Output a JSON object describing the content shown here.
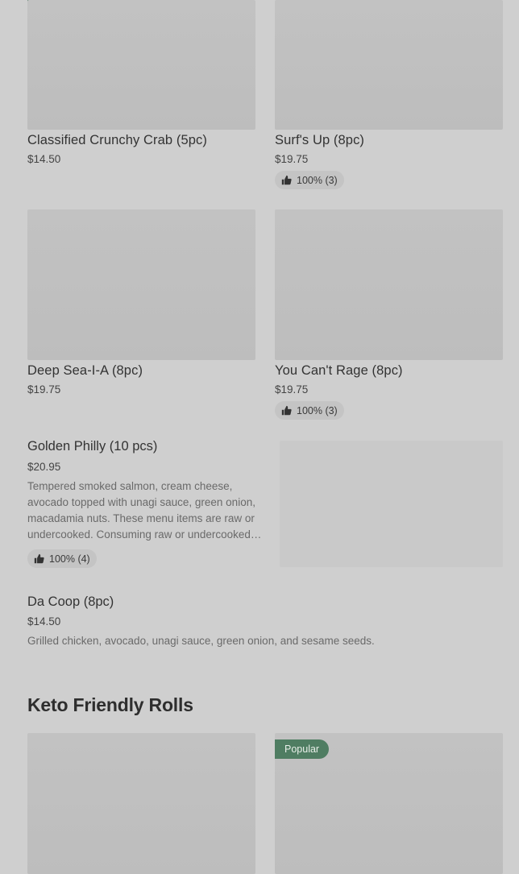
{
  "grid_row_1": [
    {
      "title": "Classified Crunchy Crab (5pc)",
      "price": "$14.50"
    },
    {
      "title": "Surf's Up (8pc)",
      "price": "$19.75",
      "rating": "100% (3)"
    }
  ],
  "grid_row_2": [
    {
      "title": "Deep Sea-I-A (8pc)",
      "price": "$19.75"
    },
    {
      "title": "You Can't Rage (8pc)",
      "price": "$19.75",
      "rating": "100% (3)"
    }
  ],
  "list_items": [
    {
      "title": "Golden Philly (10 pcs)",
      "price": "$20.95",
      "description": "Tempered smoked salmon, cream cheese, avocado topped with unagi sauce, green onion, macadamia nuts. These menu items are raw or undercooked. Consuming raw or undercooked…",
      "rating": "100% (4)"
    },
    {
      "title": "Da Coop (8pc)",
      "price": "$14.50",
      "description": "Grilled chicken, avocado, unagi sauce, green onion, and sesame seeds."
    }
  ],
  "section": {
    "heading": "Keto Friendly Rolls",
    "badge": "Popular"
  },
  "colors": {
    "popular_badge": "#4f7d62",
    "background": "#cfcfcf"
  }
}
